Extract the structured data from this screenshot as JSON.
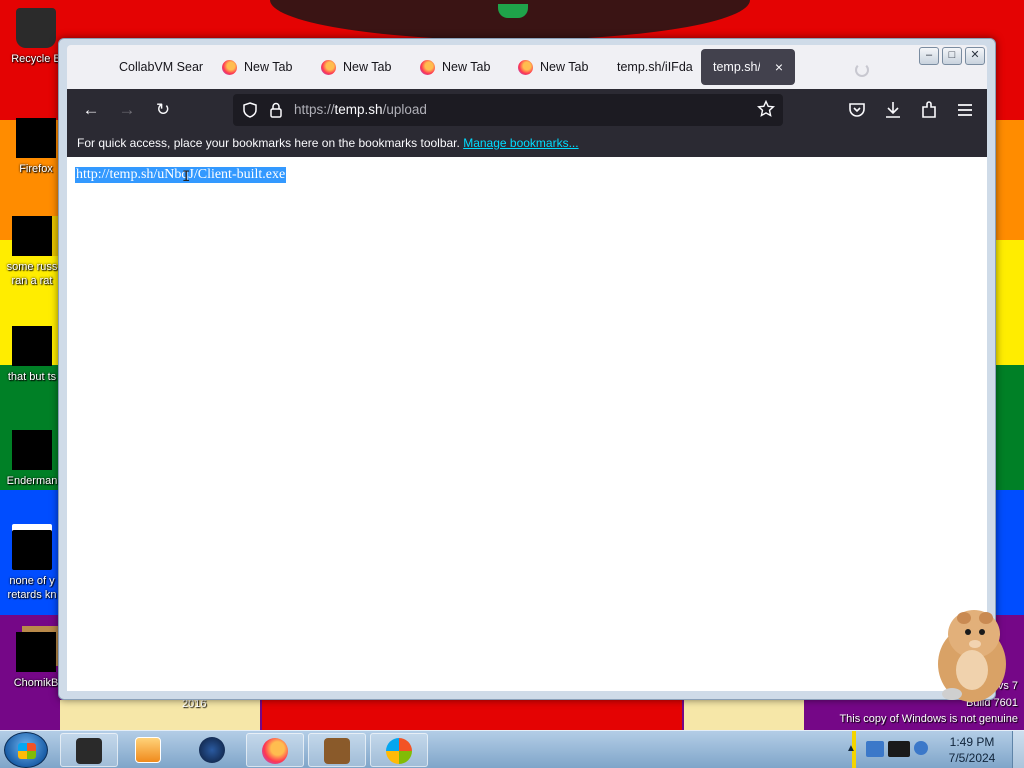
{
  "desktop": {
    "icons": [
      {
        "label": "Recycle B"
      },
      {
        "label": "Firefox"
      },
      {
        "label": "some russ",
        "label2": "ran a rat"
      },
      {
        "label": "that but ts"
      },
      {
        "label": "Enderman"
      },
      {
        "label": "none of y",
        "label2": "retards kn"
      },
      {
        "label": "ChomikB"
      }
    ],
    "bottom_label": "2016",
    "watermark": {
      "line1": "vs 7",
      "line2": "Build 7601",
      "line3": "This copy of Windows is not genuine"
    }
  },
  "browser": {
    "tabs": [
      {
        "label": "CollabVM Sear",
        "icon": "none",
        "active": false
      },
      {
        "label": "New Tab",
        "icon": "firefox-icon",
        "active": false
      },
      {
        "label": "New Tab",
        "icon": "firefox-icon",
        "active": false
      },
      {
        "label": "New Tab",
        "icon": "firefox-icon",
        "active": false
      },
      {
        "label": "New Tab",
        "icon": "firefox-icon",
        "active": false
      },
      {
        "label": "temp.sh/iIFda",
        "icon": "none",
        "active": false
      },
      {
        "label": "temp.sh/up",
        "icon": "none",
        "active": true
      }
    ],
    "tab_close_glyph": "×",
    "window_controls": {
      "minimize": "–",
      "maximize": "□",
      "close": "✕"
    },
    "nav": {
      "back": "←",
      "forward": "→",
      "reload": "↻"
    },
    "url": {
      "prefix": "https://",
      "host": "temp.sh",
      "path": "/upload"
    },
    "bookmarks_bar": {
      "text": "For quick access, place your bookmarks here on the bookmarks toolbar.",
      "link": "Manage bookmarks..."
    },
    "page": {
      "selected_text": "http://temp.sh/uNbqJ/Client-built.exe"
    }
  },
  "taskbar": {
    "clock": {
      "time": "1:49 PM",
      "date": "7/5/2024"
    },
    "items": [
      "windows-explorer",
      "media-player",
      "firefox-dark",
      "firefox",
      "chomikbox",
      "windows-logo-app"
    ]
  },
  "colors": {
    "tab_active_bg": "#42414d",
    "navbar_bg": "#2b2a33",
    "urlbar_bg": "#1c1b22",
    "selection": "#3399ff",
    "link": "#00ddff"
  }
}
